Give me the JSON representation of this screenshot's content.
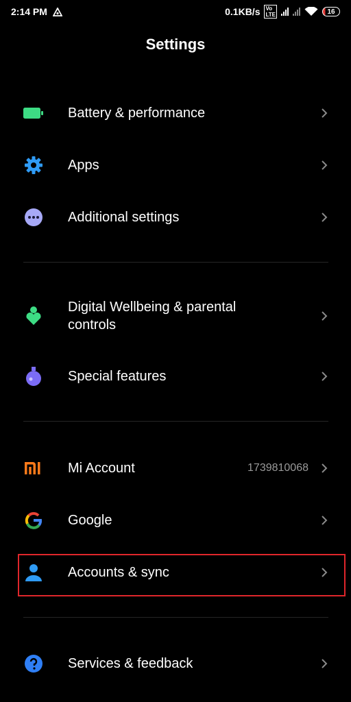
{
  "status_bar": {
    "time": "2:14 PM",
    "network_speed": "0.1KB/s",
    "volte": "Vo LTE",
    "battery_level": "16",
    "colors": {
      "battery_low": "#e53935"
    }
  },
  "page": {
    "title": "Settings"
  },
  "groups": [
    {
      "items": [
        {
          "label": "Battery & performance",
          "icon": "battery-icon",
          "icon_color": "#3ddc84"
        },
        {
          "label": "Apps",
          "icon": "gear-icon",
          "icon_color": "#2f9bf5"
        },
        {
          "label": "Additional settings",
          "icon": "more-dots-icon",
          "icon_color": "#a7a9f7"
        }
      ]
    },
    {
      "items": [
        {
          "label_line1": "Digital Wellbeing & parental",
          "label_line2": "controls",
          "icon": "wellbeing-icon",
          "icon_color": "#3ddc84"
        },
        {
          "label": "Special features",
          "icon": "flask-icon",
          "icon_color": "#7b6cf6"
        }
      ]
    },
    {
      "items": [
        {
          "label": "Mi Account",
          "value": "1739810068",
          "icon": "mi-logo-icon",
          "icon_color": "#ff7a1a"
        },
        {
          "label": "Google",
          "icon": "google-icon"
        },
        {
          "label": "Accounts & sync",
          "icon": "person-icon",
          "icon_color": "#2f9bf5",
          "highlighted": true
        }
      ]
    },
    {
      "items": [
        {
          "label": "Services & feedback",
          "icon": "help-icon",
          "icon_color": "#2f7ff5"
        }
      ]
    }
  ],
  "highlight_color": "#e0262b"
}
